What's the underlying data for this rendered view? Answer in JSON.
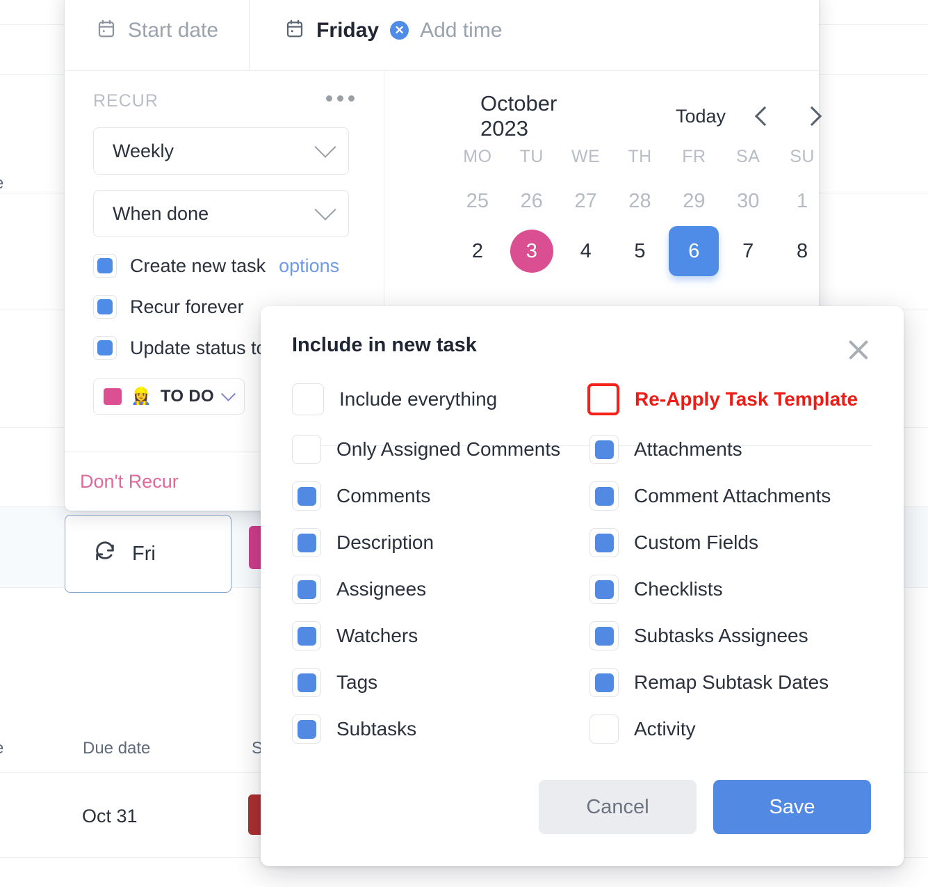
{
  "background_table": {
    "columns": [
      {
        "label": "Due date"
      },
      {
        "label": "S"
      }
    ],
    "truncated_left_label": "e",
    "rows": [
      {
        "due_date": "Oct 31",
        "status_color": "#ab2f2f"
      }
    ],
    "selected_cell": {
      "icon": "recurring-icon",
      "label": "Fri"
    },
    "selected_row_chip_color": "#cf3d8b"
  },
  "recur_popover": {
    "header": {
      "start_date": {
        "icon": "calendar-icon",
        "placeholder": "Start date"
      },
      "due_date": {
        "icon": "calendar-icon",
        "value": "Friday",
        "clear_icon": "clear-circle-icon",
        "add_time_label": "Add time"
      }
    },
    "section_label": "RECUR",
    "more_icon": "ellipsis-icon",
    "frequency_select": {
      "value": "Weekly",
      "icon": "chevron-down-icon"
    },
    "trigger_select": {
      "value": "When done",
      "icon": "chevron-down-icon"
    },
    "options": [
      {
        "label": "Create new task",
        "checked": true,
        "link": "options"
      },
      {
        "label": "Recur forever",
        "checked": true
      },
      {
        "label": "Update status to",
        "checked": true
      }
    ],
    "status_chip": {
      "swatch_color": "#dd4f93",
      "emoji": "👷‍♀️",
      "label": "TO DO",
      "icon": "chevron-down-icon"
    },
    "footer": {
      "dont_recur_label": "Don't Recur"
    }
  },
  "calendar": {
    "month_label": "October 2023",
    "today_label": "Today",
    "prev_icon": "chevron-left-icon",
    "next_icon": "chevron-right-icon",
    "weekdays": [
      "MO",
      "TU",
      "WE",
      "TH",
      "FR",
      "SA",
      "SU"
    ],
    "weeks": [
      [
        {
          "day": "25",
          "state": "muted"
        },
        {
          "day": "26",
          "state": "muted"
        },
        {
          "day": "27",
          "state": "muted"
        },
        {
          "day": "28",
          "state": "muted"
        },
        {
          "day": "29",
          "state": "muted"
        },
        {
          "day": "30",
          "state": "muted"
        },
        {
          "day": "1",
          "state": "muted"
        }
      ],
      [
        {
          "day": "2",
          "state": "normal"
        },
        {
          "day": "3",
          "state": "today"
        },
        {
          "day": "4",
          "state": "normal"
        },
        {
          "day": "5",
          "state": "normal"
        },
        {
          "day": "6",
          "state": "selected"
        },
        {
          "day": "7",
          "state": "normal"
        },
        {
          "day": "8",
          "state": "normal"
        }
      ]
    ],
    "today_color": "#d94f91",
    "selected_color": "#4f8ce8"
  },
  "include_dialog": {
    "title": "Include in new task",
    "close_icon": "close-icon",
    "top_options": [
      {
        "label": "Include everything",
        "checked": false,
        "emphasis": "none"
      },
      {
        "label": "Re-Apply Task Template",
        "checked": false,
        "emphasis": "danger"
      }
    ],
    "left_options": [
      {
        "label": "Only Assigned Comments",
        "checked": false
      },
      {
        "label": "Comments",
        "checked": true
      },
      {
        "label": "Description",
        "checked": true
      },
      {
        "label": "Assignees",
        "checked": true
      },
      {
        "label": "Watchers",
        "checked": true
      },
      {
        "label": "Tags",
        "checked": true
      },
      {
        "label": "Subtasks",
        "checked": true
      }
    ],
    "right_options": [
      {
        "label": "Attachments",
        "checked": true
      },
      {
        "label": "Comment Attachments",
        "checked": true
      },
      {
        "label": "Custom Fields",
        "checked": true
      },
      {
        "label": "Checklists",
        "checked": true
      },
      {
        "label": "Subtasks Assignees",
        "checked": true
      },
      {
        "label": "Remap Subtask Dates",
        "checked": true
      },
      {
        "label": "Activity",
        "checked": false
      }
    ],
    "cancel_label": "Cancel",
    "save_label": "Save",
    "accent_color": "#5189e3",
    "danger_color": "#ee1c17"
  }
}
